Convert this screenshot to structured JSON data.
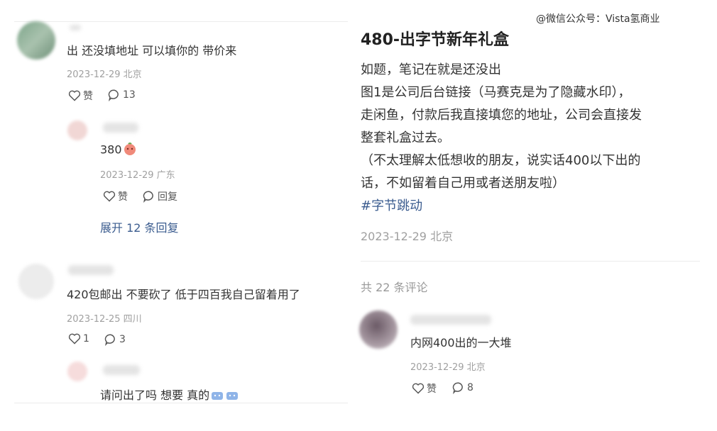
{
  "watermark": "@微信公众号：Vista氢商业",
  "left": {
    "c1": {
      "text": "出 还没填地址 可以填你的 带价来",
      "meta": "2023-12-29 北京",
      "like": "赞",
      "reply_count": "13"
    },
    "r1": {
      "text": "380",
      "meta": "2023-12-29 广东",
      "like": "赞",
      "reply": "回复",
      "expand": "展开 12 条回复"
    },
    "c2": {
      "text": "420包邮出 不要砍了 低于四百我自己留着用了",
      "meta": "2023-12-25 四川",
      "like_count": "1",
      "reply_count": "3"
    },
    "r2": {
      "text": "请问出了吗 想要 真的"
    }
  },
  "post": {
    "title": "480-出字节新年礼盒",
    "lines": [
      "如题，笔记在就是还没出",
      "图1是公司后台链接（马赛克是为了隐藏水印），",
      "走闲鱼，付款后我直接填您的地址，公司会直接发",
      "整套礼盒过去。",
      "（不太理解太低想收的朋友，说实话400以下出的",
      "话，不如留着自己用或者送朋友啦）"
    ],
    "hashtag": "#字节跳动",
    "date": "2023-12-29 北京",
    "comment_count": "共 22 条评论"
  },
  "right_comment": {
    "text": "内网400出的一大堆",
    "meta": "2023-12-29 北京",
    "like": "赞",
    "reply_count": "8"
  }
}
